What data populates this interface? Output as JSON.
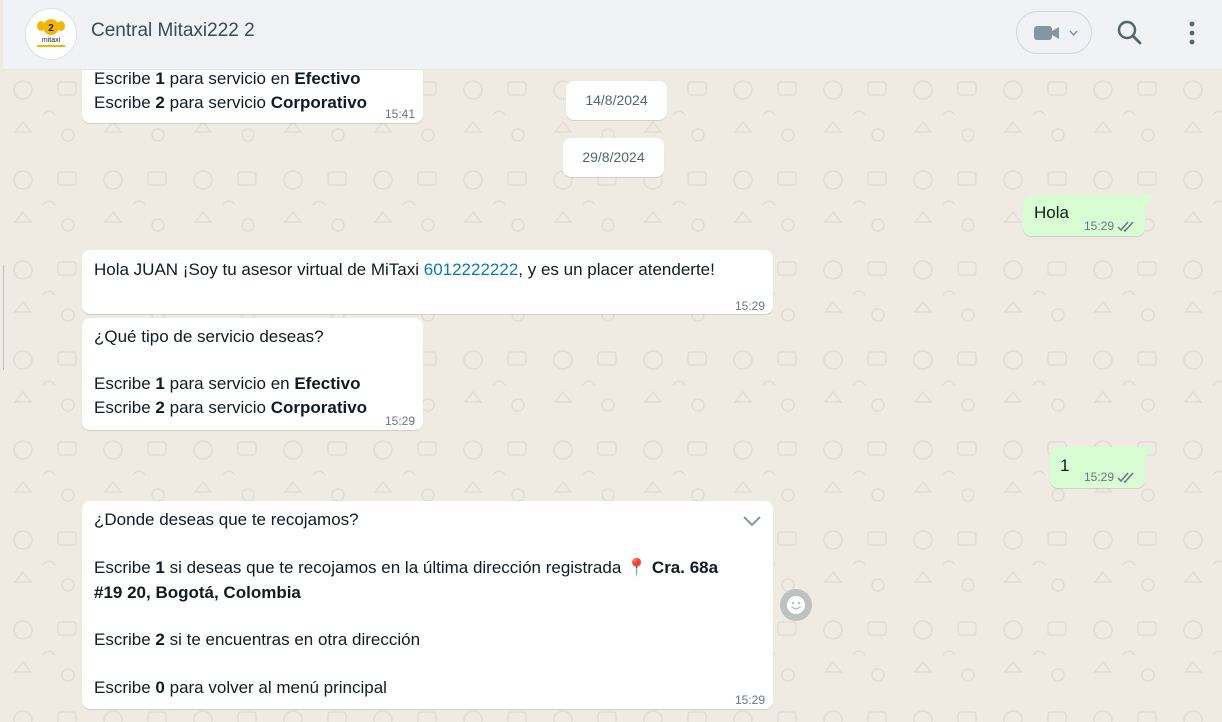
{
  "header": {
    "contact_name": "Central Mitaxi222 2",
    "avatar_text": "mitaxi",
    "icons": [
      "video-camera-icon",
      "chevron-down-icon",
      "search-icon",
      "menu-dots-icon"
    ]
  },
  "dates": [
    "14/8/2024",
    "29/8/2024"
  ],
  "messages": {
    "m0": {
      "line1_pre": "Escribe ",
      "line1_num": "1",
      "line1_mid": " para servicio en ",
      "line1_bold": "Efectivo",
      "line2_pre": "Escribe ",
      "line2_num": "2",
      "line2_mid": " para servicio ",
      "line2_bold": "Corporativo",
      "time": "15:41"
    },
    "m1": {
      "text": "Hola",
      "time": "15:29"
    },
    "m2": {
      "pre": "Hola JUAN ¡Soy tu asesor virtual de MiTaxi ",
      "phone": "6012222222",
      "post": ", y es un placer atenderte!",
      "time": "15:29"
    },
    "m3": {
      "question": "¿Qué tipo de servicio deseas?",
      "line1_pre": "Escribe ",
      "line1_num": "1",
      "line1_mid": " para servicio en ",
      "line1_bold": "Efectivo",
      "line2_pre": "Escribe ",
      "line2_num": "2",
      "line2_mid": " para servicio ",
      "line2_bold": "Corporativo",
      "time": "15:29"
    },
    "m4": {
      "text": "1",
      "time": "15:29"
    },
    "m5": {
      "question": "¿Donde deseas que te recojamos?",
      "o1_pre": "Escribe ",
      "o1_num": "1",
      "o1_mid": " si deseas que te recojamos en la última dirección registrada ",
      "pin": "📍",
      "o1_addr_a": " Cra. 68a",
      "o1_addr_b": "#19 20, Bogotá, Colombia",
      "o2_pre": "Escribe ",
      "o2_num": "2",
      "o2_mid": " si te encuentras en otra dirección",
      "o3_pre": "Escribe ",
      "o3_num": "0",
      "o3_mid": " para volver al menú principal",
      "time": "15:29"
    }
  },
  "colors": {
    "incoming": "#ffffff",
    "outgoing": "#d9fdd3",
    "wallpaper": "#efeae2",
    "header": "#f0f2f5",
    "link": "#027eb5"
  }
}
